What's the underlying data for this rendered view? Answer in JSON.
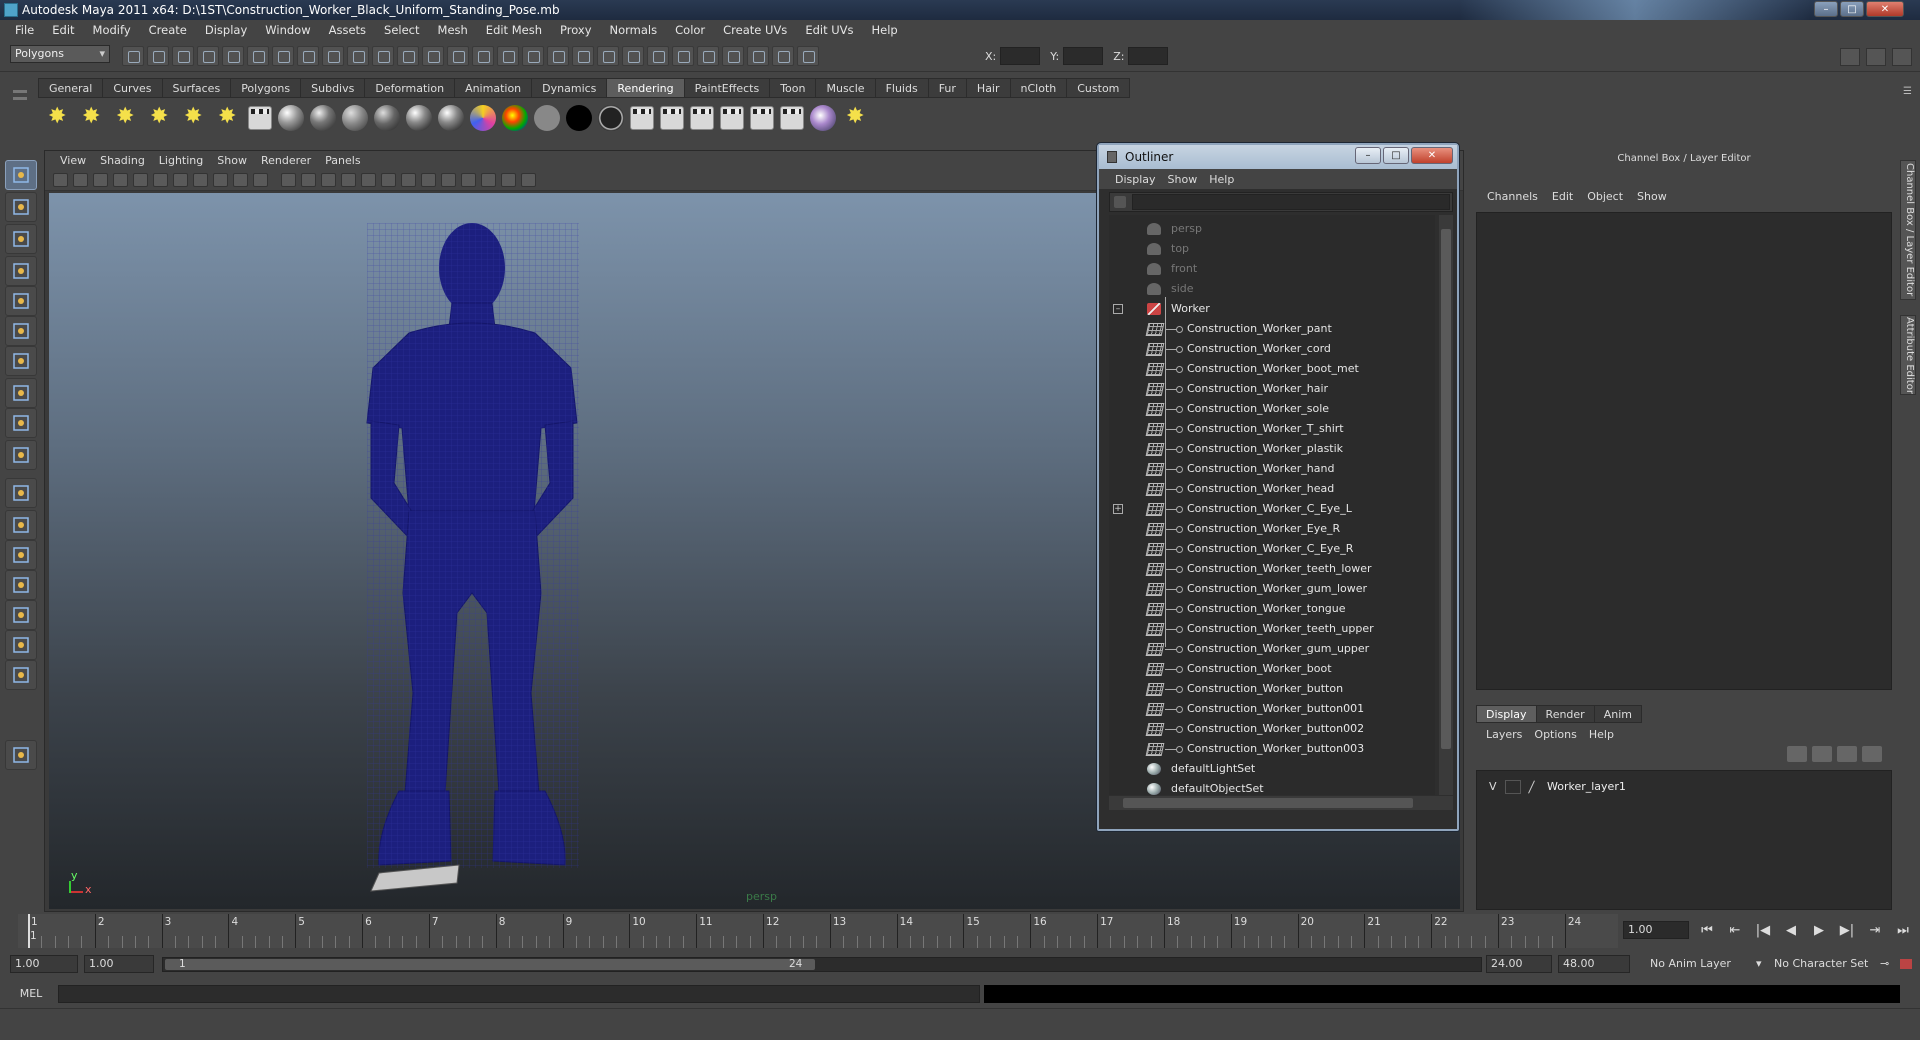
{
  "window": {
    "title": "Autodesk Maya 2011 x64: D:\\1ST\\Construction_Worker_Black_Uniform_Standing_Pose.mb",
    "minimize": "–",
    "maximize": "□",
    "close": "✕"
  },
  "menubar": [
    "File",
    "Edit",
    "Modify",
    "Create",
    "Display",
    "Window",
    "Assets",
    "Select",
    "Mesh",
    "Edit Mesh",
    "Proxy",
    "Normals",
    "Color",
    "Create UVs",
    "Edit UVs",
    "Help"
  ],
  "statusline": {
    "mode": "Polygons",
    "x_label": "X:",
    "y_label": "Y:",
    "z_label": "Z:"
  },
  "shelf": {
    "tabs": [
      "General",
      "Curves",
      "Surfaces",
      "Polygons",
      "Subdivs",
      "Deformation",
      "Animation",
      "Dynamics",
      "Rendering",
      "PaintEffects",
      "Toon",
      "Muscle",
      "Fluids",
      "Fur",
      "Hair",
      "nCloth",
      "Custom"
    ],
    "active_tab": "Rendering"
  },
  "viewport": {
    "menu": [
      "View",
      "Shading",
      "Lighting",
      "Show",
      "Renderer",
      "Panels"
    ],
    "camera_name": "persp",
    "axis_y": "y",
    "axis_x": "x",
    "mesh_color": "#1c1f7e"
  },
  "outliner": {
    "title": "Outliner",
    "menu": [
      "Display",
      "Show",
      "Help"
    ],
    "filter_value": "",
    "items": [
      {
        "label": "persp",
        "kind": "camera",
        "dim": true,
        "child": false
      },
      {
        "label": "top",
        "kind": "camera",
        "dim": true,
        "child": false
      },
      {
        "label": "front",
        "kind": "camera",
        "dim": true,
        "child": false
      },
      {
        "label": "side",
        "kind": "camera",
        "dim": true,
        "child": false
      },
      {
        "label": "Worker",
        "kind": "transform",
        "dim": false,
        "child": false,
        "expander": "–"
      },
      {
        "label": "Construction_Worker_pant",
        "kind": "mesh",
        "child": true
      },
      {
        "label": "Construction_Worker_cord",
        "kind": "mesh",
        "child": true
      },
      {
        "label": "Construction_Worker_boot_met",
        "kind": "mesh",
        "child": true
      },
      {
        "label": "Construction_Worker_hair",
        "kind": "mesh",
        "child": true
      },
      {
        "label": "Construction_Worker_sole",
        "kind": "mesh",
        "child": true
      },
      {
        "label": "Construction_Worker_T_shirt",
        "kind": "mesh",
        "child": true
      },
      {
        "label": "Construction_Worker_plastik",
        "kind": "mesh",
        "child": true
      },
      {
        "label": "Construction_Worker_hand",
        "kind": "mesh",
        "child": true
      },
      {
        "label": "Construction_Worker_head",
        "kind": "mesh",
        "child": true
      },
      {
        "label": "Construction_Worker_C_Eye_L",
        "kind": "mesh",
        "child": true,
        "expander": "+"
      },
      {
        "label": "Construction_Worker_Eye_R",
        "kind": "mesh",
        "child": true
      },
      {
        "label": "Construction_Worker_C_Eye_R",
        "kind": "mesh",
        "child": true
      },
      {
        "label": "Construction_Worker_teeth_lower",
        "kind": "mesh",
        "child": true
      },
      {
        "label": "Construction_Worker_gum_lower",
        "kind": "mesh",
        "child": true
      },
      {
        "label": "Construction_Worker_tongue",
        "kind": "mesh",
        "child": true
      },
      {
        "label": "Construction_Worker_teeth_upper",
        "kind": "mesh",
        "child": true
      },
      {
        "label": "Construction_Worker_gum_upper",
        "kind": "mesh",
        "child": true
      },
      {
        "label": "Construction_Worker_boot",
        "kind": "mesh",
        "child": true
      },
      {
        "label": "Construction_Worker_button",
        "kind": "mesh",
        "child": true
      },
      {
        "label": "Construction_Worker_button001",
        "kind": "mesh",
        "child": true
      },
      {
        "label": "Construction_Worker_button002",
        "kind": "mesh",
        "child": true
      },
      {
        "label": "Construction_Worker_button003",
        "kind": "mesh",
        "child": true
      },
      {
        "label": "defaultLightSet",
        "kind": "set",
        "child": false
      },
      {
        "label": "defaultObjectSet",
        "kind": "set",
        "child": false
      }
    ]
  },
  "channelbox": {
    "title": "Channel Box / Layer Editor",
    "menu": [
      "Channels",
      "Edit",
      "Object",
      "Show"
    ],
    "layer_tabs": [
      "Display",
      "Render",
      "Anim"
    ],
    "active_layer_tab": "Display",
    "layer_menu": [
      "Layers",
      "Options",
      "Help"
    ],
    "layers": [
      {
        "visible": "V",
        "name": "Worker_layer1"
      }
    ],
    "side_tabs": [
      "Channel Box / Layer Editor",
      "Attribute Editor"
    ]
  },
  "timeline": {
    "frames": [
      "1",
      "2",
      "3",
      "4",
      "5",
      "6",
      "7",
      "8",
      "9",
      "10",
      "11",
      "12",
      "13",
      "14",
      "15",
      "16",
      "17",
      "18",
      "19",
      "20",
      "21",
      "22",
      "23",
      "24"
    ],
    "current_frame_marker": "1",
    "current_frame": "1.00",
    "playback_buttons": [
      "⏮",
      "⇤",
      "|◀",
      "◀",
      "▶",
      "▶|",
      "⇥",
      "⏭"
    ]
  },
  "range": {
    "start_time": "1.00",
    "playback_start": "1.00",
    "slider_start": "1",
    "slider_end": "24",
    "playback_end": "24.00",
    "end_time": "48.00",
    "anim_layer": "No Anim Layer",
    "character_set": "No Character Set"
  },
  "cmdline": {
    "label": "MEL"
  }
}
